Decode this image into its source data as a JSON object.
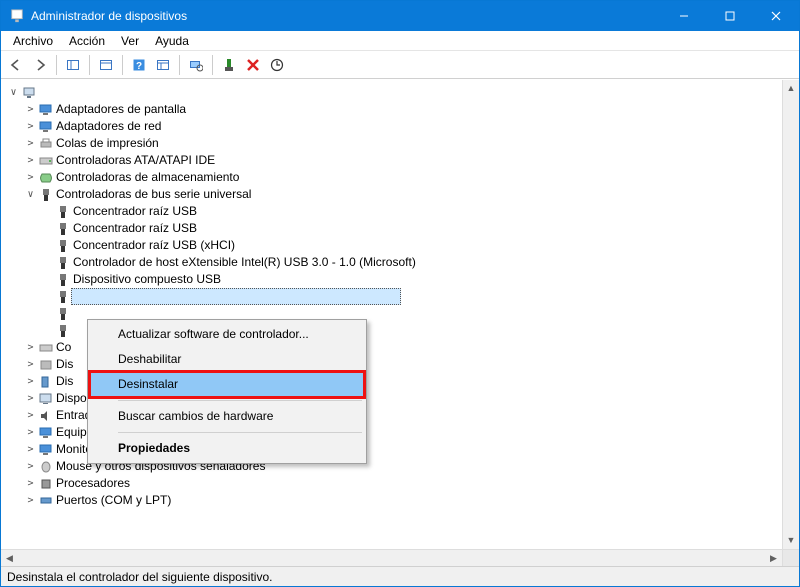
{
  "titlebar": {
    "title": "Administrador de dispositivos"
  },
  "menubar": {
    "items": [
      {
        "label": "Archivo"
      },
      {
        "label": "Acción"
      },
      {
        "label": "Ver"
      },
      {
        "label": "Ayuda"
      }
    ]
  },
  "tree": {
    "root_expander": "∨",
    "nodes": [
      {
        "icon": "display",
        "label": "Adaptadores de pantalla",
        "expander": ">"
      },
      {
        "icon": "network",
        "label": "Adaptadores de red",
        "expander": ">"
      },
      {
        "icon": "printer",
        "label": "Colas de impresión",
        "expander": ">"
      },
      {
        "icon": "ide",
        "label": "Controladoras ATA/ATAPI IDE",
        "expander": ">"
      },
      {
        "icon": "storage",
        "label": "Controladoras de almacenamiento",
        "expander": ">"
      },
      {
        "icon": "usb",
        "label": "Controladoras de bus serie universal",
        "expander": "∨",
        "children": [
          {
            "icon": "usb",
            "label": "Concentrador raíz USB"
          },
          {
            "icon": "usb",
            "label": "Concentrador raíz USB"
          },
          {
            "icon": "usb",
            "label": "Concentrador raíz USB (xHCI)"
          },
          {
            "icon": "usb",
            "label": "Controlador de host eXtensible Intel(R) USB 3.0 - 1.0 (Microsoft)"
          },
          {
            "icon": "usb",
            "label": "Dispositivo compuesto USB"
          },
          {
            "icon": "usb",
            "label": "",
            "selected": true
          },
          {
            "icon": "usb",
            "label": ""
          },
          {
            "icon": "usb",
            "label": ""
          }
        ]
      },
      {
        "icon": "ide",
        "label": "Co",
        "expander": ">"
      },
      {
        "icon": "hid",
        "label": "Dis",
        "expander": ">"
      },
      {
        "icon": "portable",
        "label": "Dis",
        "expander": ">"
      },
      {
        "icon": "system",
        "label": "Dispositivos del sistema",
        "expander": ">"
      },
      {
        "icon": "audio",
        "label": "Entradas y salidas de audio",
        "expander": ">"
      },
      {
        "icon": "computer",
        "label": "Equipo",
        "expander": ">"
      },
      {
        "icon": "monitor",
        "label": "Monitores",
        "expander": ">"
      },
      {
        "icon": "mouse",
        "label": "Mouse y otros dispositivos señaladores",
        "expander": ">"
      },
      {
        "icon": "cpu",
        "label": "Procesadores",
        "expander": ">"
      },
      {
        "icon": "port",
        "label": "Puertos (COM y LPT)",
        "expander": ">"
      }
    ]
  },
  "context_menu": {
    "items": [
      {
        "label": "Actualizar software de controlador...",
        "type": "item"
      },
      {
        "label": "Deshabilitar",
        "type": "item"
      },
      {
        "label": "Desinstalar",
        "type": "item",
        "highlighted": true
      },
      {
        "type": "sep"
      },
      {
        "label": "Buscar cambios de hardware",
        "type": "item"
      },
      {
        "type": "sep"
      },
      {
        "label": "Propiedades",
        "type": "item",
        "bold": true
      }
    ]
  },
  "statusbar": {
    "text": "Desinstala el controlador del siguiente dispositivo."
  }
}
